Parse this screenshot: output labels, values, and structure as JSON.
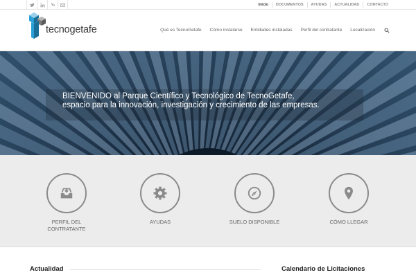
{
  "topbar": {
    "social": [
      {
        "icon": "twitter-icon",
        "name": "twitter"
      },
      {
        "icon": "linkedin-icon",
        "name": "linkedin"
      },
      {
        "icon": "youtube-icon",
        "name": "youtube"
      },
      {
        "icon": "mail-icon",
        "name": "mail"
      }
    ],
    "nav": [
      "Inicio",
      "DOCUMENTOS",
      "AYUDAS",
      "ACTUALIDAD",
      "CONTACTO"
    ]
  },
  "header": {
    "logo_text": "tecnogetafe",
    "brand_color": "#2a9fd6",
    "nav": [
      "Qué es TecnoGetafe",
      "Cómo instalarse",
      "Entidades instaladas",
      "Perfil del contratante",
      "Localización"
    ]
  },
  "hero": {
    "line1": "BIENVENIDO al Parque Científico y Tecnológico de TecnoGetafe,",
    "line2": "espacio para la innovación, investigación y crecimiento de las empresas."
  },
  "features": [
    {
      "icon": "inbox-icon",
      "line1": "PERFIL DEL",
      "line2": "CONTRATANTE"
    },
    {
      "icon": "gear-icon",
      "line1": "AYUDAS",
      "line2": ""
    },
    {
      "icon": "compass-icon",
      "line1": "SUELO DISPONIBLE",
      "line2": ""
    },
    {
      "icon": "location-pin-icon",
      "line1": "CÓMO LLEGAR",
      "line2": ""
    }
  ],
  "sections": {
    "news_title": "Actualidad",
    "calendar_title": "Calendario de Licitaciones"
  }
}
